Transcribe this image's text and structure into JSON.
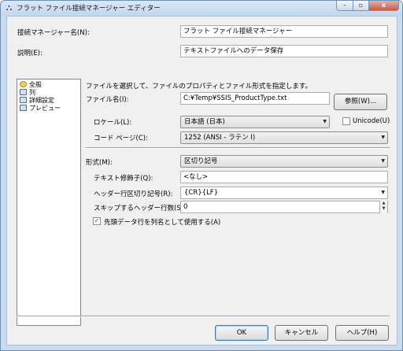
{
  "window": {
    "title": "フラット ファイル接続マネージャー エディター",
    "minimize_glyph": "–",
    "maximize_glyph": "▫",
    "close_glyph": "x"
  },
  "connection_manager_name": {
    "label": "接続マネージャー名(N):",
    "value": "フラット ファイル接続マネージャー"
  },
  "description": {
    "label": "説明(E):",
    "value": "テキストファイルへのデータ保存"
  },
  "nav": {
    "items": [
      {
        "label": "全般",
        "icon": "general-icon"
      },
      {
        "label": "列",
        "icon": "columns-icon"
      },
      {
        "label": "詳細設定",
        "icon": "advanced-icon"
      },
      {
        "label": "プレビュー",
        "icon": "preview-icon"
      }
    ],
    "selected_index": 0
  },
  "main": {
    "instruction": "ファイルを選択して、ファイルのプロパティとファイル形式を指定します。",
    "file_name": {
      "label": "ファイル名(I):",
      "value": "C:¥Temp¥SSIS_ProductType.txt"
    },
    "browse_button": "参照(W)...",
    "locale": {
      "label": "ロケール(L):",
      "value": "日本語 (日本)"
    },
    "unicode": {
      "label": "Unicode(U)",
      "checked": false
    },
    "code_page": {
      "label": "コード ページ(C):",
      "value": "1252  (ANSI - ラテン I)"
    },
    "format": {
      "label": "形式(M):",
      "value": "区切り記号"
    },
    "text_qualifier": {
      "label": "テキスト修飾子(Q):",
      "value": "<なし>"
    },
    "header_row_delimiter": {
      "label": "ヘッダー行区切り記号(R):",
      "value": "{CR}{LF}"
    },
    "header_rows_to_skip": {
      "label": "スキップするヘッダー行数(S):",
      "value": "0"
    },
    "column_names_first_row": {
      "label": "先頭データ行を列名として使用する(A)",
      "checked": true
    }
  },
  "buttons": {
    "ok": "OK",
    "cancel": "キャンセル",
    "help": "ヘルプ(H)"
  },
  "colors": {
    "frame": "#c9dcef",
    "client": "#f0f0f0",
    "close_button": "#c85a43",
    "default_button_border": "#3c7fb1"
  }
}
